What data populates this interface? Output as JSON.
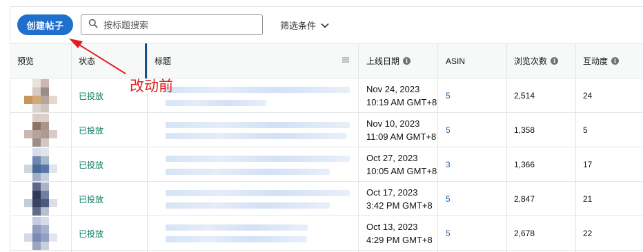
{
  "toolbar": {
    "create_post_label": "创建帖子",
    "search_placeholder": "按标题搜索",
    "filter_label": "筛选条件"
  },
  "table": {
    "headers": {
      "preview": "预览",
      "status": "状态",
      "title": "标题",
      "launch_date": "上线日期",
      "asin": "ASIN",
      "views": "浏览次数",
      "engagement": "互动度"
    },
    "rows": [
      {
        "status": "已投放",
        "date": "Nov 24, 2023",
        "time": "10:19 AM GMT+8",
        "asin": "5",
        "views": "2,514",
        "engagement": "24"
      },
      {
        "status": "已投放",
        "date": "Nov 10, 2023",
        "time": "11:09 AM GMT+8",
        "asin": "5",
        "views": "1,358",
        "engagement": "5"
      },
      {
        "status": "已投放",
        "date": "Oct 27, 2023",
        "time": "10:05 AM GMT+8",
        "asin": "3",
        "views": "1,366",
        "engagement": "17"
      },
      {
        "status": "已投放",
        "date": "Oct 17, 2023",
        "time": "3:42 PM GMT+8",
        "asin": "5",
        "views": "2,847",
        "engagement": "21"
      },
      {
        "status": "已投放",
        "date": "Oct 13, 2023",
        "time": "4:29 PM GMT+8",
        "asin": "5",
        "views": "2,678",
        "engagement": "22"
      }
    ]
  },
  "annotation": {
    "text": "改动前",
    "color": "#e11d1d"
  },
  "icons": {
    "search": "search-icon",
    "filter_chevron": "chevron-down-icon",
    "info": "info-icon",
    "drag": "drag-handle-icon"
  },
  "colors": {
    "primary_button": "#1f6fcd",
    "status_text": "#067d62",
    "link_text": "#2162a1"
  }
}
